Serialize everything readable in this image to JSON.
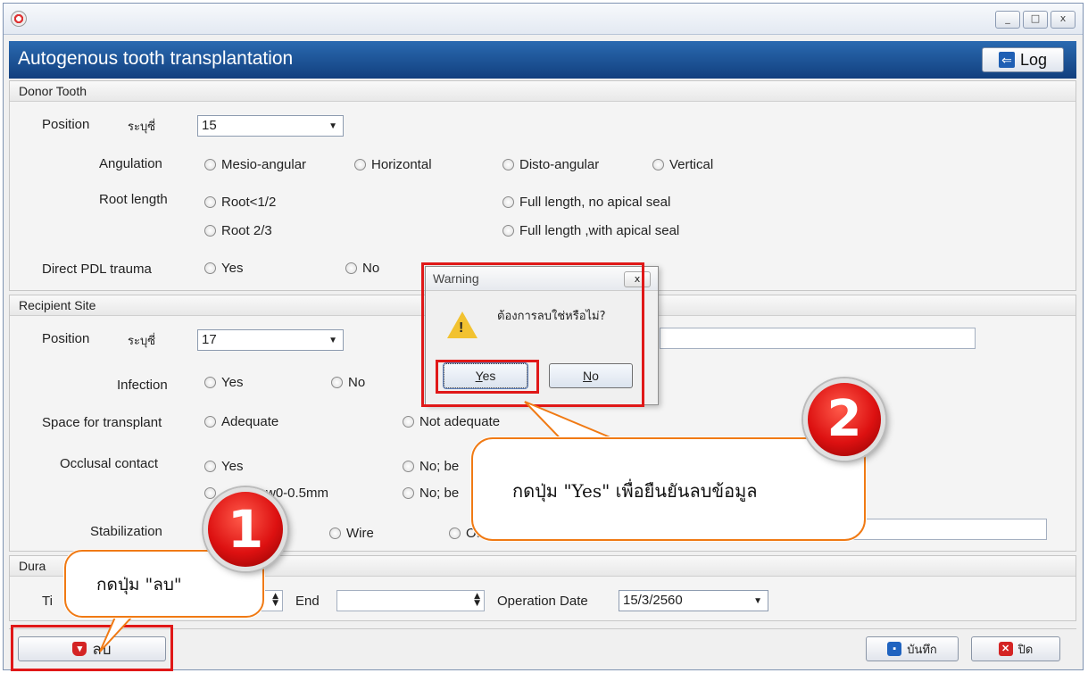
{
  "window": {
    "buttons": [
      "_",
      "□",
      "x"
    ]
  },
  "header": {
    "title": "Autogenous tooth transplantation",
    "log_label": "Log"
  },
  "donor": {
    "section_title": "Donor Tooth",
    "position_label": "Position",
    "specify_label": "ระบุซี่",
    "position_value": "15",
    "angulation_label": "Angulation",
    "angulation_options": [
      "Mesio-angular",
      "Horizontal",
      "Disto-angular",
      "Vertical"
    ],
    "root_length_label": "Root length",
    "root_options": [
      "Root<1/2",
      "Full length, no apical seal",
      "Root 2/3",
      "Full length ,with apical seal"
    ],
    "pdl_label": "Direct PDL trauma",
    "pdl_options": [
      "Yes",
      "No"
    ]
  },
  "recipient": {
    "section_title": "Recipient Site",
    "position_label": "Position",
    "specify_label": "ระบุซี่",
    "position_value": "17",
    "infection_label": "Infection",
    "infection_options": [
      "Yes",
      "No"
    ],
    "space_label": "Space for transplant",
    "space_options": [
      "Adequate",
      "Not adequate"
    ],
    "occlusal_label": "Occlusal contact",
    "occlusal_options": [
      "Yes",
      "No; be",
      "w0-0.5mm",
      "No; be"
    ],
    "stabilization_label": "Stabilization",
    "stabilization_options": [
      "Wire",
      "Oth"
    ]
  },
  "duration": {
    "section_title": "Dura",
    "time_label": "Ti",
    "end_label": "End",
    "operation_date_label": "Operation Date",
    "operation_date_value": "15/3/2560"
  },
  "dialog": {
    "title": "Warning",
    "close": "x",
    "message": "ต้องการลบใช่หรือไม่?",
    "yes_rest": "es",
    "yes_hotkey": "Y",
    "no_rest": "o",
    "no_hotkey": "N"
  },
  "callouts": {
    "step1_number": "1",
    "step1_text": "กดปุ่ม \"ลบ\"",
    "step2_number": "2",
    "step2_text": "กดปุ่ม \"Yes\" เพื่อยืนยันลบข้อมูล"
  },
  "toolbar": {
    "delete_label": "ลบ",
    "save_label": "บันทึก",
    "close_label": "ปิด"
  },
  "colors": {
    "header_blue": "#1b4f95",
    "highlight_red": "#e01818",
    "callout_orange": "#f07a14"
  }
}
